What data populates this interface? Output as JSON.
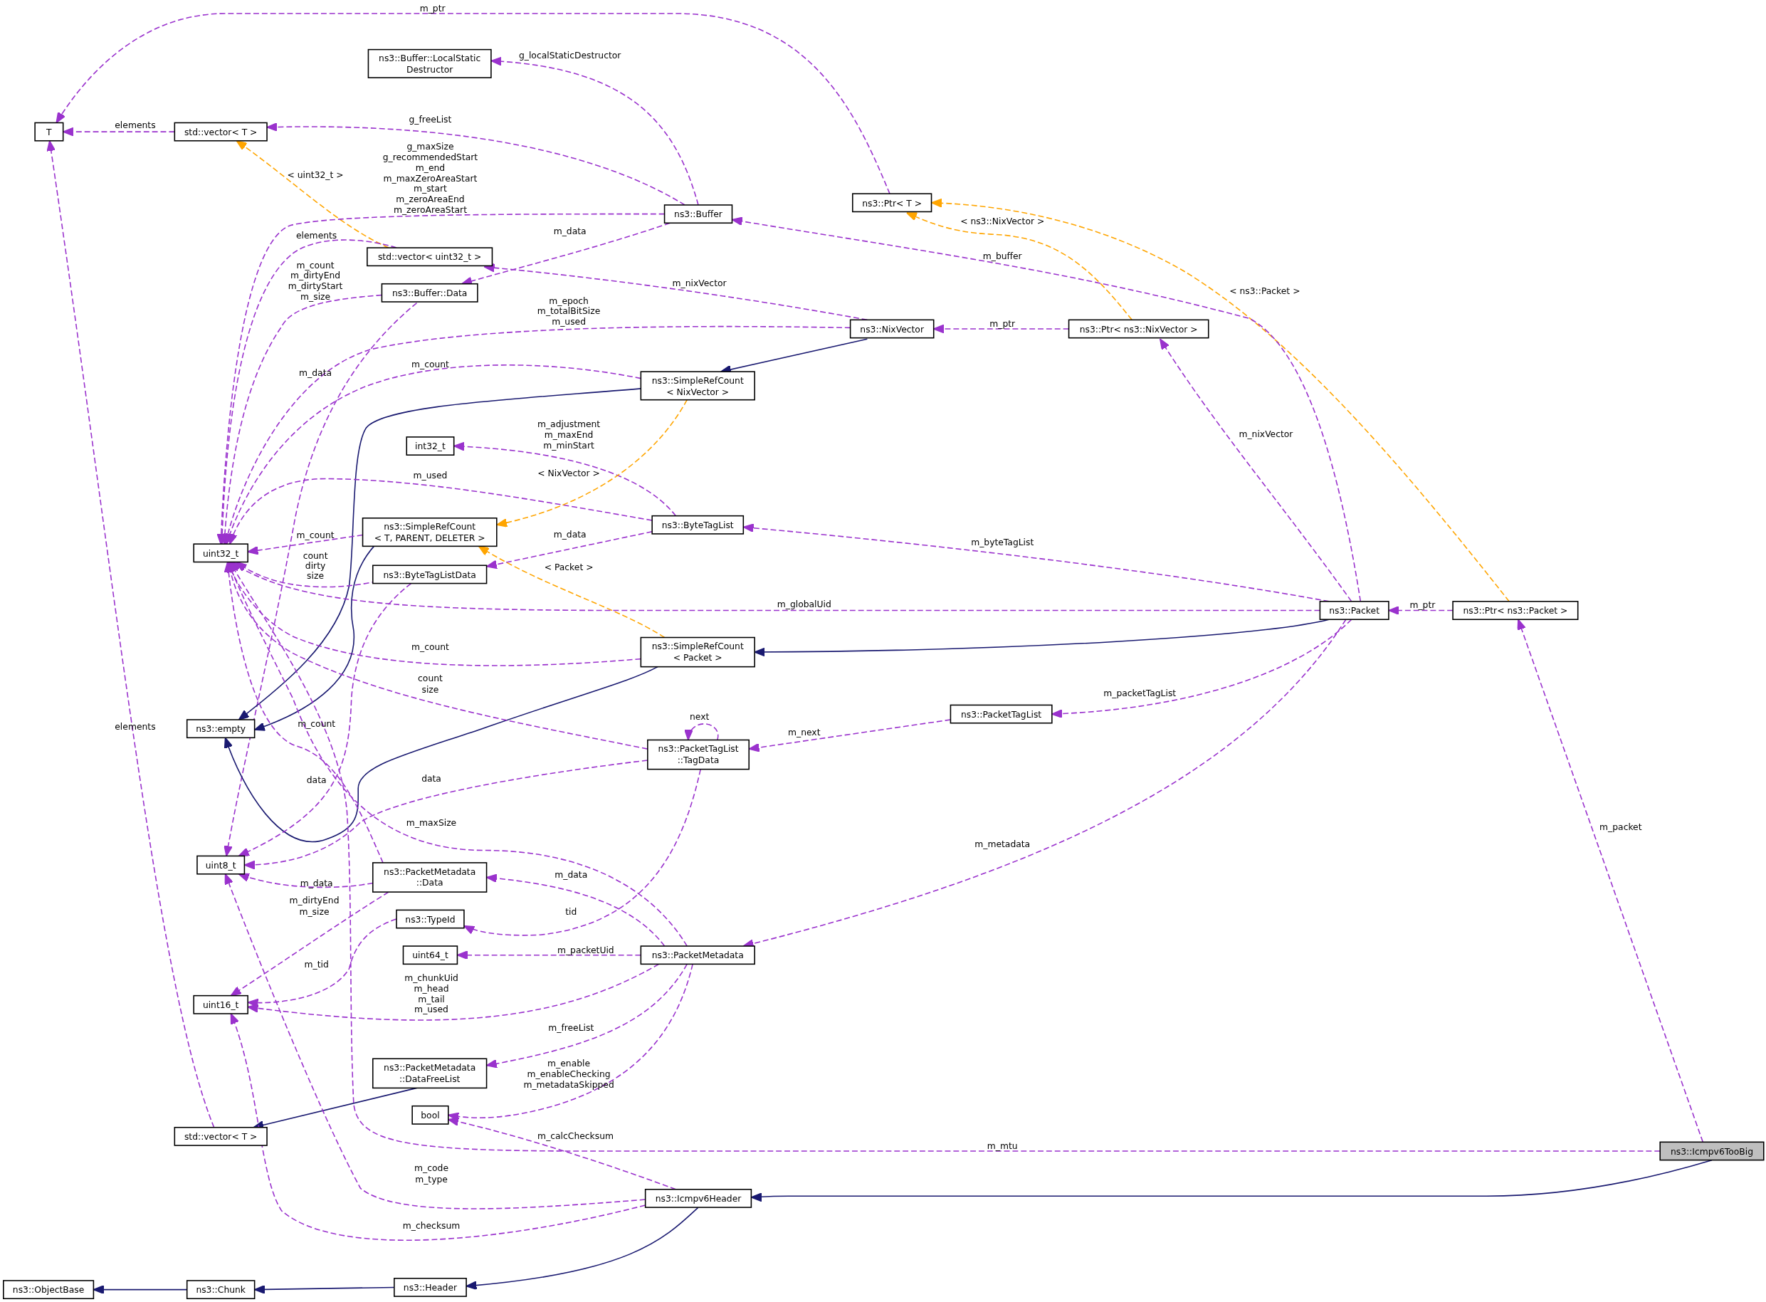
{
  "diagram": {
    "nodes": [
      {
        "lines": [
          "T"
        ],
        "highlighted": false
      },
      {
        "lines": [
          "std::vector< T >"
        ],
        "highlighted": false
      },
      {
        "lines": [
          "ns3::Buffer::LocalStatic",
          "Destructor"
        ],
        "highlighted": false
      },
      {
        "lines": [
          "ns3::Ptr< T >"
        ],
        "highlighted": false
      },
      {
        "lines": [
          "ns3::Buffer"
        ],
        "highlighted": false
      },
      {
        "lines": [
          "std::vector< uint32_t >"
        ],
        "highlighted": false
      },
      {
        "lines": [
          "ns3::Buffer::Data"
        ],
        "highlighted": false
      },
      {
        "lines": [
          "ns3::NixVector"
        ],
        "highlighted": false
      },
      {
        "lines": [
          "ns3::Ptr< ns3::NixVector >"
        ],
        "highlighted": false
      },
      {
        "lines": [
          "ns3::SimpleRefCount",
          "< NixVector >"
        ],
        "highlighted": false
      },
      {
        "lines": [
          "int32_t"
        ],
        "highlighted": false
      },
      {
        "lines": [
          "ns3::SimpleRefCount",
          "< T, PARENT, DELETER >"
        ],
        "highlighted": false
      },
      {
        "lines": [
          "ns3::ByteTagList"
        ],
        "highlighted": false
      },
      {
        "lines": [
          "uint32_t"
        ],
        "highlighted": false
      },
      {
        "lines": [
          "ns3::ByteTagListData"
        ],
        "highlighted": false
      },
      {
        "lines": [
          "ns3::Packet"
        ],
        "highlighted": false
      },
      {
        "lines": [
          "ns3::Ptr< ns3::Packet >"
        ],
        "highlighted": false
      },
      {
        "lines": [
          "ns3::SimpleRefCount",
          "< Packet >"
        ],
        "highlighted": false
      },
      {
        "lines": [
          "ns3::PacketTagList"
        ],
        "highlighted": false
      },
      {
        "lines": [
          "ns3::empty"
        ],
        "highlighted": false
      },
      {
        "lines": [
          "ns3::PacketTagList",
          "::TagData"
        ],
        "highlighted": false
      },
      {
        "lines": [
          "uint8_t"
        ],
        "highlighted": false
      },
      {
        "lines": [
          "ns3::PacketMetadata",
          "::Data"
        ],
        "highlighted": false
      },
      {
        "lines": [
          "ns3::TypeId"
        ],
        "highlighted": false
      },
      {
        "lines": [
          "uint64_t"
        ],
        "highlighted": false
      },
      {
        "lines": [
          "ns3::PacketMetadata"
        ],
        "highlighted": false
      },
      {
        "lines": [
          "uint16_t"
        ],
        "highlighted": false
      },
      {
        "lines": [
          "ns3::PacketMetadata",
          "::DataFreeList"
        ],
        "highlighted": false
      },
      {
        "lines": [
          "bool"
        ],
        "highlighted": false
      },
      {
        "lines": [
          "std::vector< T >"
        ],
        "highlighted": false
      },
      {
        "lines": [
          "ns3::Icmpv6TooBig"
        ],
        "highlighted": true
      },
      {
        "lines": [
          "ns3::Icmpv6Header"
        ],
        "highlighted": false
      },
      {
        "lines": [
          "ns3::ObjectBase"
        ],
        "highlighted": false
      },
      {
        "lines": [
          "ns3::Chunk"
        ],
        "highlighted": false
      },
      {
        "lines": [
          "ns3::Header"
        ],
        "highlighted": false
      }
    ],
    "edges": [
      {
        "kind": "member",
        "lines": [
          "m_ptr"
        ]
      },
      {
        "kind": "member",
        "lines": [
          "g_localStaticDestructor"
        ]
      },
      {
        "kind": "member",
        "lines": [
          "g_freeList"
        ]
      },
      {
        "kind": "member",
        "lines": [
          "elements"
        ]
      },
      {
        "kind": "template",
        "lines": [
          "< uint32_t >"
        ]
      },
      {
        "kind": "member",
        "lines": [
          "g_maxSize",
          "g_recommendedStart",
          "m_end",
          "m_maxZeroAreaStart",
          "m_start",
          "m_zeroAreaEnd",
          "m_zeroAreaStart"
        ]
      },
      {
        "kind": "member",
        "lines": [
          "elements"
        ]
      },
      {
        "kind": "member",
        "lines": [
          "m_data"
        ]
      },
      {
        "kind": "member",
        "lines": [
          "m_count",
          "m_dirtyEnd",
          "m_dirtyStart",
          "m_size"
        ]
      },
      {
        "kind": "member",
        "lines": [
          "m_nixVector"
        ]
      },
      {
        "kind": "member",
        "lines": [
          "m_data"
        ]
      },
      {
        "kind": "member",
        "lines": [
          "m_epoch",
          "m_totalBitSize",
          "m_used"
        ]
      },
      {
        "kind": "member",
        "lines": [
          "m_count"
        ]
      },
      {
        "kind": "inherit"
      },
      {
        "kind": "inherit"
      },
      {
        "kind": "member",
        "lines": [
          "m_adjustment",
          "m_maxEnd",
          "m_minStart"
        ]
      },
      {
        "kind": "member",
        "lines": [
          "m_used"
        ]
      },
      {
        "kind": "template",
        "lines": [
          "< NixVector >"
        ]
      },
      {
        "kind": "member",
        "lines": [
          "m_count"
        ]
      },
      {
        "kind": "member",
        "lines": [
          "m_data"
        ]
      },
      {
        "kind": "member",
        "lines": [
          "count",
          "dirty",
          "size"
        ]
      },
      {
        "kind": "template",
        "lines": [
          "< Packet >"
        ]
      },
      {
        "kind": "member",
        "lines": [
          "m_byteTagList"
        ]
      },
      {
        "kind": "member",
        "lines": [
          "m_globalUid"
        ]
      },
      {
        "kind": "template",
        "lines": [
          "< ns3::Packet >"
        ]
      },
      {
        "kind": "template",
        "lines": [
          "< ns3::NixVector >"
        ]
      },
      {
        "kind": "member",
        "lines": [
          "m_buffer"
        ]
      },
      {
        "kind": "member",
        "lines": [
          "m_ptr"
        ]
      },
      {
        "kind": "member",
        "lines": [
          "m_nixVector"
        ]
      },
      {
        "kind": "member",
        "lines": [
          "m_ptr"
        ]
      },
      {
        "kind": "inherit"
      },
      {
        "kind": "member",
        "lines": [
          "m_count"
        ]
      },
      {
        "kind": "inherit"
      },
      {
        "kind": "inherit"
      },
      {
        "kind": "member",
        "lines": [
          "count",
          "size"
        ]
      },
      {
        "kind": "member",
        "lines": [
          "m_packetTagList"
        ]
      },
      {
        "kind": "member",
        "lines": [
          "m_next"
        ]
      },
      {
        "kind": "member",
        "lines": [
          "m_count"
        ]
      },
      {
        "kind": "member",
        "lines": [
          "next"
        ]
      },
      {
        "kind": "member",
        "lines": [
          "data"
        ]
      },
      {
        "kind": "member",
        "lines": [
          "data"
        ]
      },
      {
        "kind": "member",
        "lines": [
          "m_maxSize"
        ]
      },
      {
        "kind": "member",
        "lines": [
          "m_metadata"
        ]
      },
      {
        "kind": "member",
        "lines": [
          "m_data"
        ]
      },
      {
        "kind": "member",
        "lines": [
          "m_data"
        ]
      },
      {
        "kind": "member",
        "lines": [
          "m_dirtyEnd",
          "m_size"
        ]
      },
      {
        "kind": "member",
        "lines": [
          "tid"
        ]
      },
      {
        "kind": "member",
        "lines": [
          "m_packetUid"
        ]
      },
      {
        "kind": "member",
        "lines": [
          "m_tid"
        ]
      },
      {
        "kind": "member",
        "lines": [
          "m_chunkUid",
          "m_head",
          "m_tail",
          "m_used"
        ]
      },
      {
        "kind": "member",
        "lines": [
          "m_freeList"
        ]
      },
      {
        "kind": "member",
        "lines": [
          "m_enable",
          "m_enableChecking",
          "m_metadataSkipped"
        ]
      },
      {
        "kind": "inherit"
      },
      {
        "kind": "member",
        "lines": [
          "elements"
        ]
      },
      {
        "kind": "member",
        "lines": [
          "m_calcChecksum"
        ]
      },
      {
        "kind": "member",
        "lines": [
          "m_mtu"
        ]
      },
      {
        "kind": "member",
        "lines": [
          "m_code",
          "m_type"
        ]
      },
      {
        "kind": "member",
        "lines": [
          "m_checksum"
        ]
      },
      {
        "kind": "member",
        "lines": [
          "m_packet"
        ]
      },
      {
        "kind": "inherit"
      },
      {
        "kind": "inherit"
      },
      {
        "kind": "inherit"
      },
      {
        "kind": "inherit"
      }
    ]
  }
}
